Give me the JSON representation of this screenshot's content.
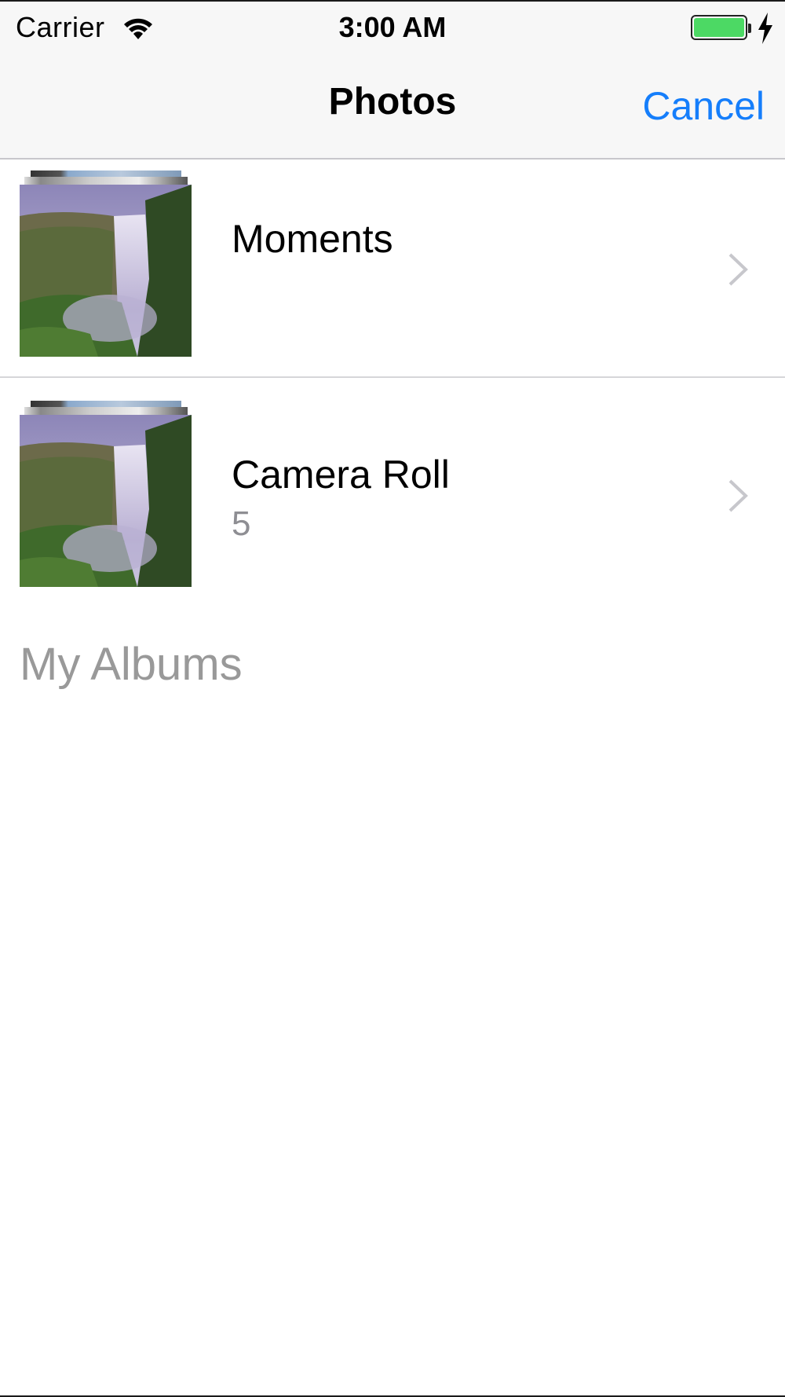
{
  "status_bar": {
    "carrier": "Carrier",
    "time": "3:00 AM",
    "battery_level": 1.0,
    "charging": true,
    "wifi_icon": "wifi-icon",
    "battery_color": "#4cd964"
  },
  "nav": {
    "title": "Photos",
    "cancel_label": "Cancel",
    "accent_color": "#157efb"
  },
  "albums": [
    {
      "label": "Moments",
      "count": "",
      "thumbnail": "waterfall-photo",
      "chevron": "chevron-right-icon"
    },
    {
      "label": "Camera Roll",
      "count": "5",
      "thumbnail": "waterfall-photo",
      "chevron": "chevron-right-icon"
    }
  ],
  "section": {
    "header": "My Albums"
  }
}
